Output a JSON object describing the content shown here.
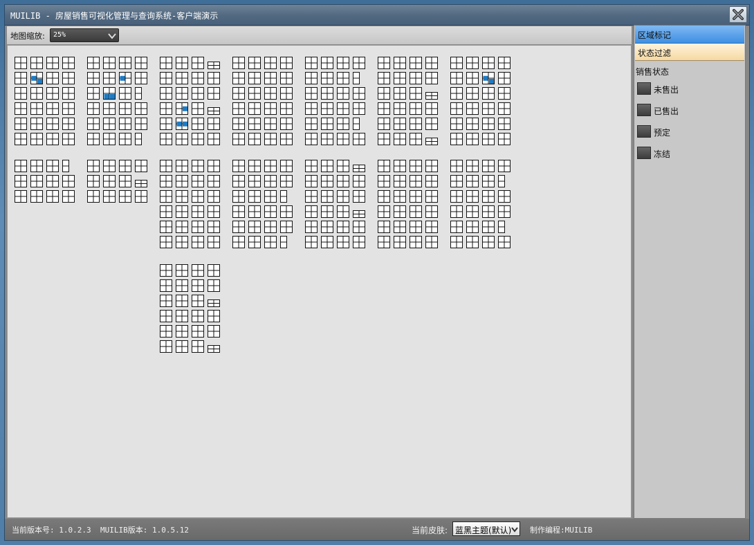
{
  "window": {
    "title": "MUILIB - 房屋销售可视化管理与查询系统-客户端演示"
  },
  "toolbar": {
    "zoom_label": "地图缩放:",
    "zoom_value": "25%"
  },
  "side_panel": {
    "tab_region": "区域标记",
    "tab_filter": "状态过滤",
    "status_title": "销售状态",
    "statuses": [
      {
        "label": "未售出"
      },
      {
        "label": "已售出"
      },
      {
        "label": "预定"
      },
      {
        "label": "冻结"
      }
    ]
  },
  "statusbar": {
    "version_label": "当前版本号: 1.0.2.3",
    "muilib_version": "MUILIB版本: 1.0.5.12",
    "skin_label": "当前皮肤:",
    "skin_value": "蓝黑主题(默认)",
    "author": "制作编程:MUILIB"
  },
  "colors": {
    "highlight_unit": "#1e7bc4",
    "tab_region": "#3e8fe2",
    "tab_filter": "#f6d9a1"
  },
  "map": {
    "highlighted_units": [
      {
        "building": 0,
        "row": 1,
        "col": 1,
        "cell": [
          1,
          0
        ]
      },
      {
        "building": 0,
        "row": 1,
        "col": 1,
        "cell": [
          2,
          1
        ]
      },
      {
        "building": 1,
        "row": 1,
        "col": 2,
        "cell": [
          1,
          0
        ]
      },
      {
        "building": 1,
        "row": 2,
        "col": 1,
        "cell": [
          2,
          0
        ]
      },
      {
        "building": 1,
        "row": 2,
        "col": 1,
        "cell": [
          2,
          1
        ]
      },
      {
        "building": 2,
        "row": 3,
        "col": 1,
        "cell": [
          1,
          1
        ]
      },
      {
        "building": 2,
        "row": 4,
        "col": 1,
        "cell": [
          1,
          0
        ]
      },
      {
        "building": 2,
        "row": 4,
        "col": 1,
        "cell": [
          1,
          1
        ]
      },
      {
        "building": 6,
        "row": 1,
        "col": 2,
        "cell": [
          1,
          0
        ]
      },
      {
        "building": 6,
        "row": 1,
        "col": 2,
        "cell": [
          2,
          1
        ]
      }
    ]
  }
}
